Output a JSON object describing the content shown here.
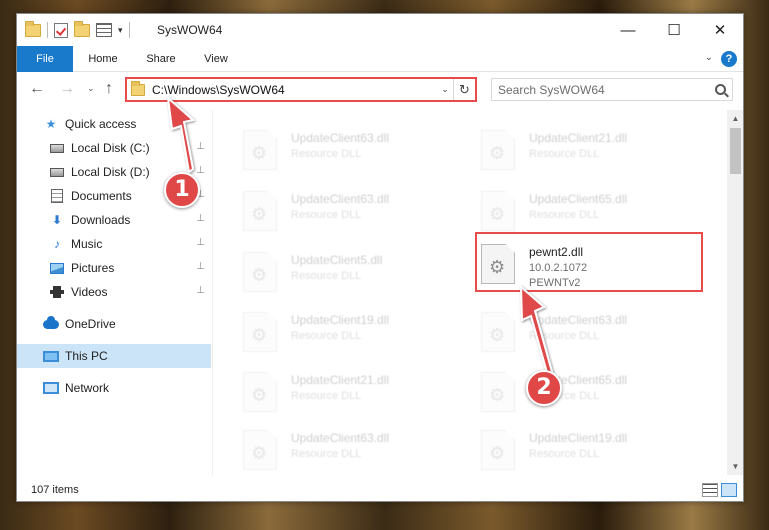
{
  "window": {
    "title": "SysWOW64",
    "controls": {
      "minimize": "—",
      "maximize": "☐",
      "close": "✕"
    }
  },
  "ribbon": {
    "tabs": [
      "File",
      "Home",
      "Share",
      "View"
    ],
    "expand_glyph": "⌄",
    "help_glyph": "?"
  },
  "nav": {
    "back_glyph": "←",
    "forward_glyph": "→",
    "recent_glyph": "⌄",
    "up_glyph": "↑",
    "address": "C:\\Windows\\SysWOW64",
    "address_dd_glyph": "⌄",
    "refresh_glyph": "↻",
    "search_placeholder": "Search SysWOW64"
  },
  "sidebar": {
    "items": [
      {
        "label": "Quick access",
        "icon": "star-icon"
      },
      {
        "label": "Local Disk (C:)",
        "icon": "drive-icon",
        "pinned": true
      },
      {
        "label": "Local Disk (D:)",
        "icon": "drive-icon",
        "pinned": true
      },
      {
        "label": "Documents",
        "icon": "documents-icon",
        "pinned": true
      },
      {
        "label": "Downloads",
        "icon": "download-icon",
        "pinned": true
      },
      {
        "label": "Music",
        "icon": "music-icon",
        "pinned": true
      },
      {
        "label": "Pictures",
        "icon": "pictures-icon",
        "pinned": true
      },
      {
        "label": "Videos",
        "icon": "video-icon",
        "pinned": true
      },
      {
        "label": "OneDrive",
        "icon": "cloud-icon"
      },
      {
        "label": "This PC",
        "icon": "computer-icon",
        "selected": true
      },
      {
        "label": "Network",
        "icon": "network-icon"
      }
    ],
    "pin_glyph": "📌"
  },
  "files": {
    "left_column": [
      {
        "name": "UpdateClient63.dll",
        "desc": "Resource DLL"
      },
      {
        "name": "UpdateClient63.dll",
        "desc": "Resource DLL"
      },
      {
        "name": "UpdateClient5.dll",
        "desc": "Resource DLL"
      },
      {
        "name": "UpdateClient19.dll",
        "desc": "Resource DLL"
      },
      {
        "name": "UpdateClient21.dll",
        "desc": "Resource DLL"
      },
      {
        "name": "UpdateClient63.dll",
        "desc": "Resource DLL"
      }
    ],
    "right_column": [
      {
        "name": "UpdateClient21.dll",
        "desc": "Resource DLL"
      },
      {
        "name": "UpdateClient65.dll",
        "desc": "Resource DLL"
      },
      {
        "name": "pewnt2.dll",
        "version": "10.0.2.1072",
        "desc": "PEWNTv2",
        "highlighted": true
      },
      {
        "name": "UpdateClient63.dll",
        "desc": "Resource DLL"
      },
      {
        "name": "UpdateClient65.dll",
        "desc": "Resource DLL"
      },
      {
        "name": "UpdateClient19.dll",
        "desc": "Resource DLL"
      }
    ]
  },
  "scrollbar": {
    "up_glyph": "▲",
    "down_glyph": "▼"
  },
  "status": {
    "item_count": "107 items"
  },
  "annotations": {
    "step1": "1",
    "step2": "2",
    "color": "#e04848"
  }
}
